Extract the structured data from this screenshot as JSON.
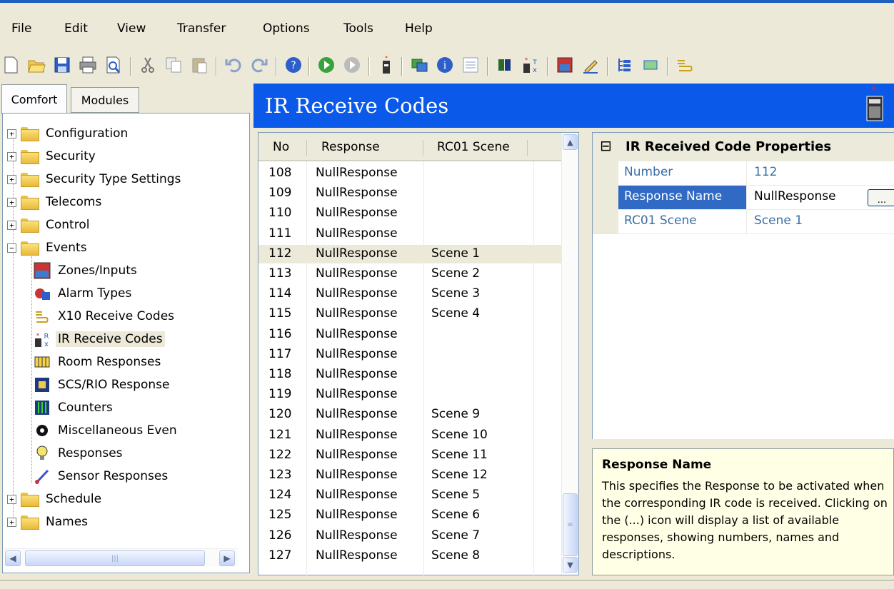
{
  "menu": [
    "File",
    "Edit",
    "View",
    "Transfer",
    "Options",
    "Tools",
    "Help"
  ],
  "tabs": [
    "Comfort",
    "Modules"
  ],
  "tree": {
    "top_items": [
      "Configuration",
      "Security",
      "Security Type Settings",
      "Telecoms",
      "Control",
      "Events"
    ],
    "event_children": [
      "Zones/Inputs",
      "Alarm Types",
      "X10 Receive Codes",
      "IR Receive Codes",
      "Room Responses",
      "SCS/RIO Response",
      "Counters",
      "Miscellaneous Even",
      "Responses",
      "Sensor Responses"
    ],
    "bottom_items": [
      "Schedule",
      "Names"
    ],
    "selected": "IR Receive Codes"
  },
  "banner": {
    "title": "IR Receive Codes"
  },
  "grid": {
    "columns": [
      "No",
      "Response",
      "RC01 Scene"
    ],
    "selected_no": "112",
    "rows": [
      [
        "108",
        "NullResponse",
        ""
      ],
      [
        "109",
        "NullResponse",
        ""
      ],
      [
        "110",
        "NullResponse",
        ""
      ],
      [
        "111",
        "NullResponse",
        ""
      ],
      [
        "112",
        "NullResponse",
        "Scene 1"
      ],
      [
        "113",
        "NullResponse",
        "Scene 2"
      ],
      [
        "114",
        "NullResponse",
        "Scene 3"
      ],
      [
        "115",
        "NullResponse",
        "Scene 4"
      ],
      [
        "116",
        "NullResponse",
        ""
      ],
      [
        "117",
        "NullResponse",
        ""
      ],
      [
        "118",
        "NullResponse",
        ""
      ],
      [
        "119",
        "NullResponse",
        ""
      ],
      [
        "120",
        "NullResponse",
        "Scene 9"
      ],
      [
        "121",
        "NullResponse",
        "Scene 10"
      ],
      [
        "122",
        "NullResponse",
        "Scene 11"
      ],
      [
        "123",
        "NullResponse",
        "Scene 12"
      ],
      [
        "124",
        "NullResponse",
        "Scene 5"
      ],
      [
        "125",
        "NullResponse",
        "Scene 6"
      ],
      [
        "126",
        "NullResponse",
        "Scene 7"
      ],
      [
        "127",
        "NullResponse",
        "Scene 8"
      ]
    ]
  },
  "props": {
    "title": "IR Received Code Properties",
    "collapse_glyph": "⊟",
    "ellipsis": "...",
    "rows": [
      {
        "name": "Number",
        "value": "112"
      },
      {
        "name": "Response Name",
        "value": "NullResponse"
      },
      {
        "name": "RC01 Scene",
        "value": "Scene 1"
      }
    ]
  },
  "help": {
    "title": "Response Name",
    "text": "This specifies the Response to be activated when the corresponding IR code is received.   Clicking on the (...) icon will display a list of available responses, showing numbers, names and descriptions."
  },
  "colors": {
    "banner": "#0b59e8",
    "selected_prop": "#316ac5",
    "help_bg": "#ffffe5"
  }
}
